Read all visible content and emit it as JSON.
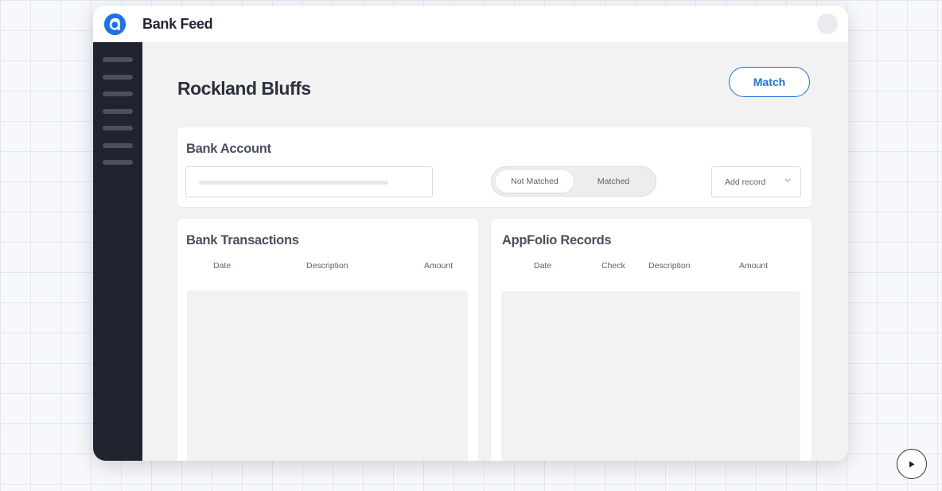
{
  "app": {
    "title": "Bank Feed",
    "accent_color": "#1a73e8"
  },
  "page": {
    "title": "Rockland Bluffs",
    "match_button": "Match"
  },
  "bank_account": {
    "title": "Bank Account",
    "filter_options": [
      "Not Matched",
      "Matched"
    ],
    "selected_filter": "Not Matched",
    "add_record_label": "Add record"
  },
  "bank_transactions": {
    "title": "Bank Transactions",
    "columns": [
      "Date",
      "Description",
      "Amount"
    ]
  },
  "appfolio_records": {
    "title": "AppFolio Records",
    "columns": [
      "Date",
      "Check",
      "Description",
      "Amount"
    ]
  },
  "icons": {
    "logo": "appfolio-logo-icon",
    "chevron": "chevron-down-icon",
    "play": "play-icon"
  }
}
